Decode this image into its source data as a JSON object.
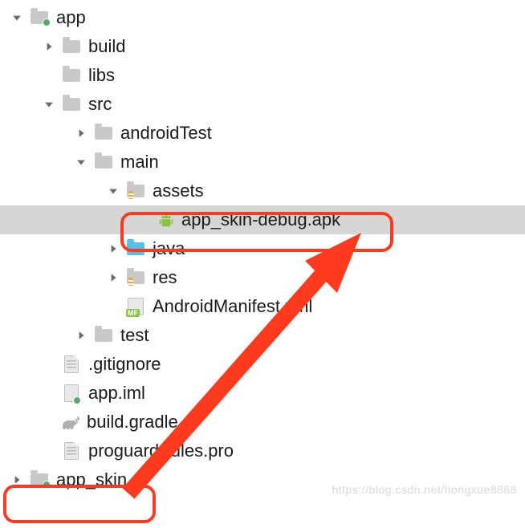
{
  "tree": {
    "app": "app",
    "build": "build",
    "libs": "libs",
    "src": "src",
    "androidTest": "androidTest",
    "main": "main",
    "assets": "assets",
    "apk": "app_skin-debug.apk",
    "java": "java",
    "res": "res",
    "manifest": "AndroidManifest.xml",
    "test": "test",
    "gitignore": ".gitignore",
    "iml": "app.iml",
    "gradle": "build.gradle",
    "proguard": "proguard-rules.pro",
    "app_skin": "app_skin"
  },
  "watermark": "https://blog.csdn.net/hongxue8888"
}
